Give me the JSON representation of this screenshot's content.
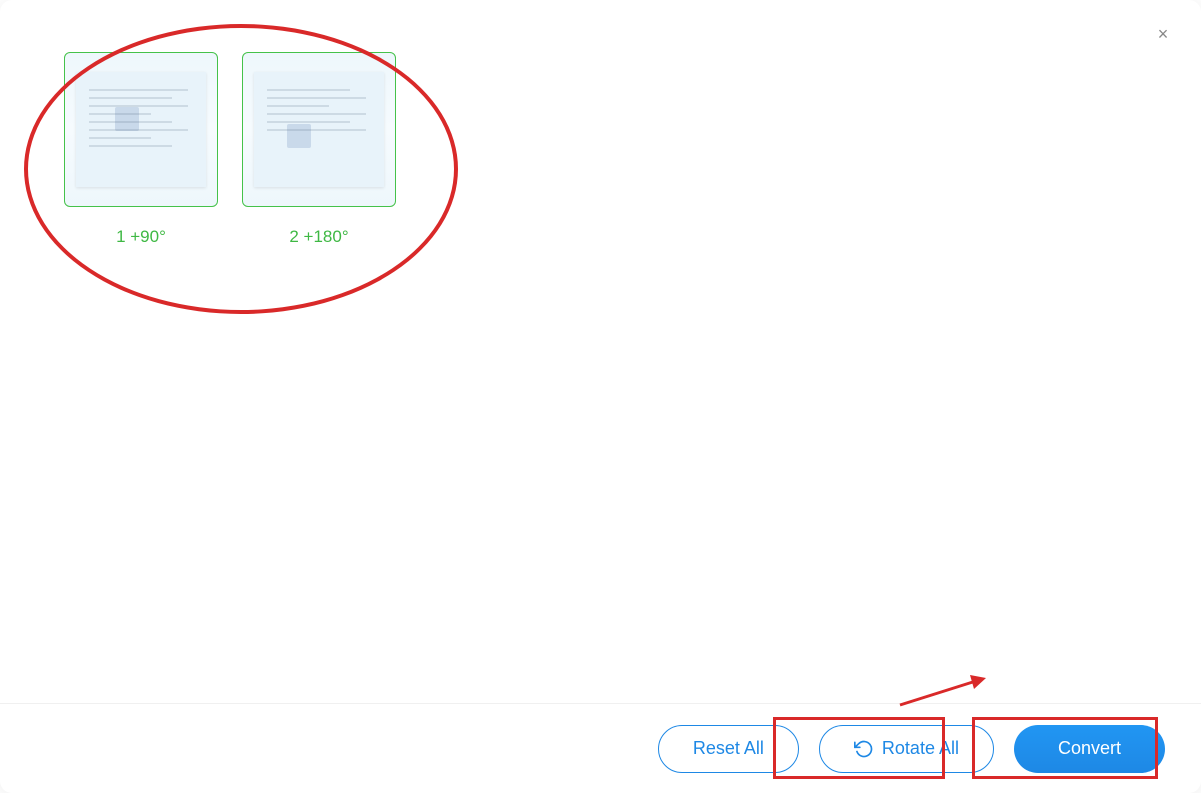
{
  "close": {
    "label": "×"
  },
  "thumbnails": [
    {
      "label": "1 +90°",
      "rotation": 90
    },
    {
      "label": "2 +180°",
      "rotation": 180
    }
  ],
  "footer": {
    "reset_label": "Reset All",
    "rotate_label": "Rotate All",
    "convert_label": "Convert"
  },
  "colors": {
    "accent_blue": "#1e88e5",
    "accent_green": "#45c24a",
    "annotation_red": "#d92929"
  }
}
